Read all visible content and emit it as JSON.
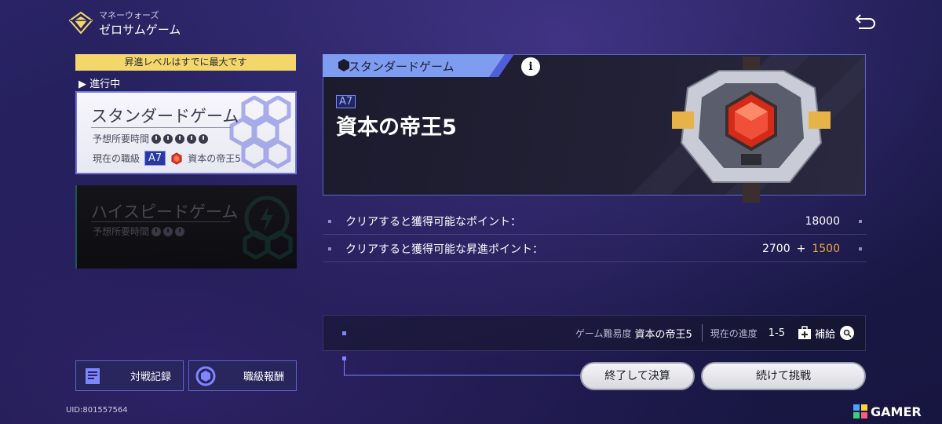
{
  "header": {
    "subtitle": "マネーウォーズ",
    "title": "ゼロサムゲーム"
  },
  "left": {
    "max_level_notice": "昇進レベルはすでに最大です",
    "in_progress_label": "▶ 進行中",
    "modes": [
      {
        "title": "スタンダードゲーム",
        "time_label": "予想所要時間",
        "time_clocks": 5,
        "rank_label": "現在の職級",
        "rank_code": "A7",
        "rank_name": "資本の帝王5",
        "active": true
      },
      {
        "title": "ハイスピードゲーム",
        "time_label": "予想所要時間",
        "time_clocks": 3,
        "active": false
      }
    ],
    "buttons": {
      "battle_record": "対戦記録",
      "rank_reward": "職級報酬"
    },
    "uid": "UID:801557564"
  },
  "main": {
    "mode_tag": "スタンダードゲーム",
    "info_icon": "i",
    "rank_code": "A7",
    "rank_name": "資本の帝王5",
    "stats": [
      {
        "label": "クリアすると獲得可能なポイント：",
        "value": "18000"
      },
      {
        "label": "クリアすると獲得可能な昇進ポイント：",
        "value": "2700",
        "plus": "+",
        "bonus": "1500"
      }
    ],
    "info_bar": {
      "difficulty_label": "ゲーム難易度",
      "difficulty_value": "資本の帝王5",
      "progress_label": "現在の進度",
      "progress_value": "1-5",
      "supply_label": "補給"
    },
    "actions": {
      "finish": "終了して決算",
      "continue": "続けて挑戦"
    }
  },
  "watermark": "GAMER",
  "colors": {
    "accent_blue": "#5b63c9",
    "notice_yellow": "#f3d76a",
    "bonus_orange": "#f2a93a",
    "gem_red": "#e23a22"
  }
}
